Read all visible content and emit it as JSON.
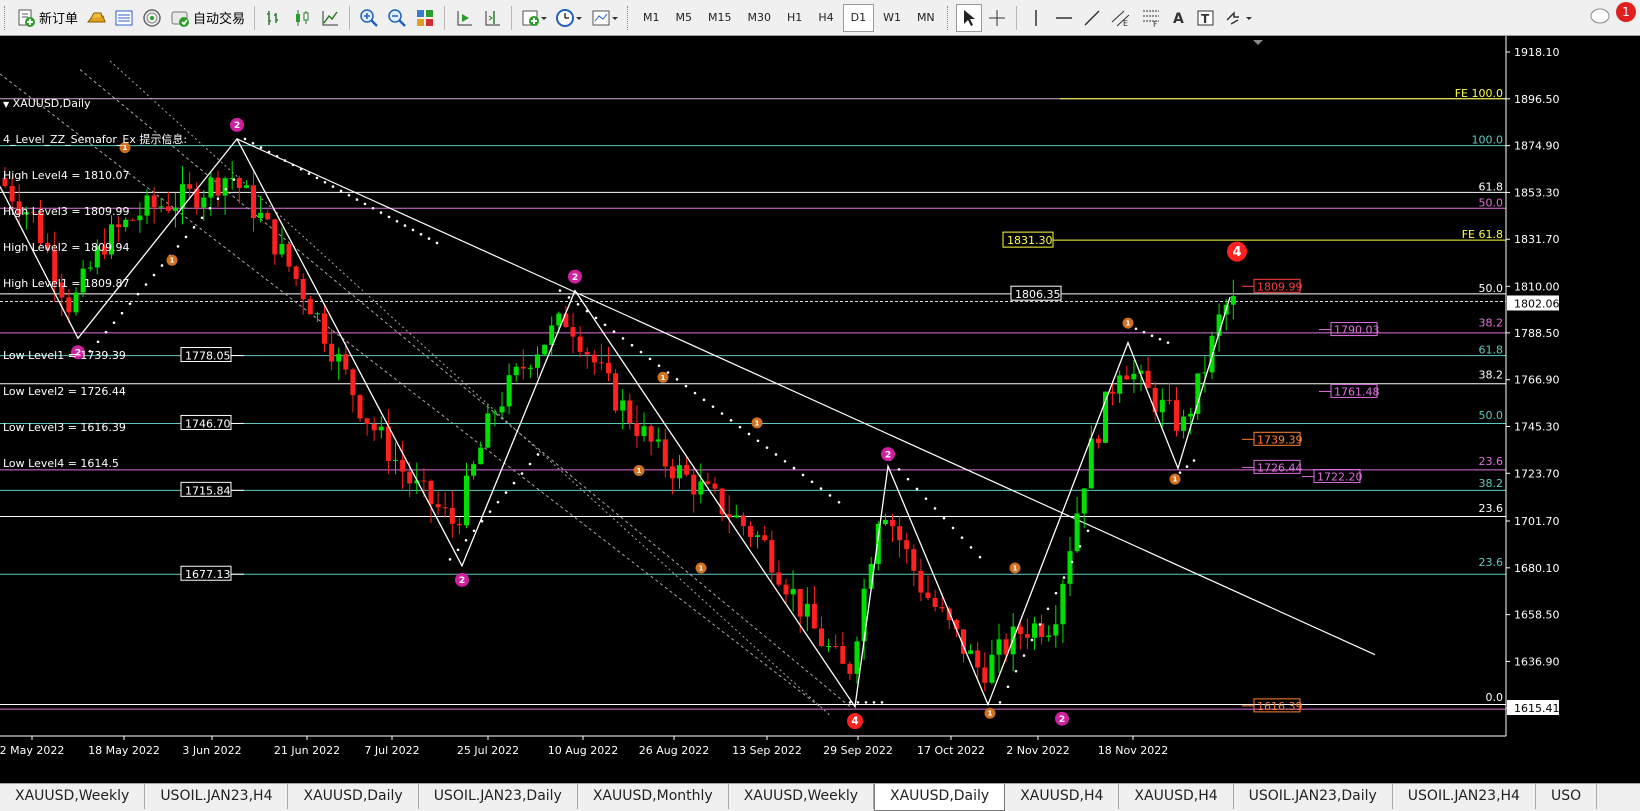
{
  "toolbar": {
    "new_order_label": "新订单",
    "auto_trade_label": "自动交易",
    "timeframes": [
      "M1",
      "M5",
      "M15",
      "M30",
      "H1",
      "H4",
      "D1",
      "W1",
      "MN"
    ],
    "active_timeframe": "D1",
    "notification_count": "1"
  },
  "chart": {
    "symbol_label": "XAUUSD,Daily",
    "indicator_label": "4_Level_ZZ_Semafor_Ex 提示信息:",
    "levels_text": [
      "High Level4 = 1810.07",
      "High Level3 = 1809.99",
      "High Level2 = 1809.94",
      "High Level1 = 1809.87",
      "",
      "Low Level1 = 1739.39",
      "Low Level2 = 1726.44",
      "Low Level3 = 1616.39",
      "Low Level4 = 1614.5"
    ],
    "current_price": "1802.06",
    "low_price_marker": "1615.41",
    "price_scale": [
      "1918.10",
      "1896.50",
      "1874.90",
      "1853.30",
      "1831.70",
      "1810.00",
      "1788.50",
      "1766.90",
      "1745.30",
      "1723.70",
      "1701.70",
      "1680.10",
      "1658.50",
      "1636.90",
      "1615.41"
    ],
    "date_scale": [
      "2 May 2022",
      "18 May 2022",
      "3 Jun 2022",
      "21 Jun 2022",
      "7 Jul 2022",
      "25 Jul 2022",
      "10 Aug 2022",
      "26 Aug 2022",
      "13 Sep 2022",
      "29 Sep 2022",
      "17 Oct 2022",
      "2 Nov 2022",
      "18 Nov 2022"
    ],
    "price_boxes": [
      "1778.05",
      "1746.70",
      "1715.84",
      "1677.13",
      "1806.35",
      "1831.30"
    ],
    "fib_labels": {
      "fe100": "FE 100.0",
      "r100": "100.0",
      "r618a": "61.8",
      "r500a": "50.0",
      "fe618": "FE 61.8",
      "r500b": "50.0",
      "r382a": "38.2",
      "r618b": "61.8",
      "r382b": "38.2",
      "r500c": "50.0",
      "r236a": "23.6",
      "r382c": "38.2",
      "r236b": "23.6",
      "r236c": "23.6",
      "r00": "0.0"
    },
    "right_tags": {
      "high_tag": "1809.99",
      "tag_1790": "1790.03",
      "tag_1761": "1761.48",
      "tag_1739": "1739.39",
      "tag_1726": "1726.44",
      "tag_1722": "1722.20",
      "tag_1616": "1616.39"
    },
    "semafor_big_label": "4",
    "semafor_mid_label": "2",
    "semafor_small_label": "1",
    "colors": {
      "bull": "#00e000",
      "bear": "#ff2020",
      "background": "#000000"
    }
  },
  "tabs": [
    "XAUUSD,Weekly",
    "USOIL.JAN23,H4",
    "XAUUSD,Daily",
    "USOIL.JAN23,Daily",
    "XAUUSD,Monthly",
    "XAUUSD,Weekly",
    "XAUUSD,Daily",
    "XAUUSD,H4",
    "XAUUSD,H4",
    "USOIL.JAN23,Daily",
    "USOIL.JAN23,H4",
    "USO"
  ],
  "active_tab_index": 6
}
